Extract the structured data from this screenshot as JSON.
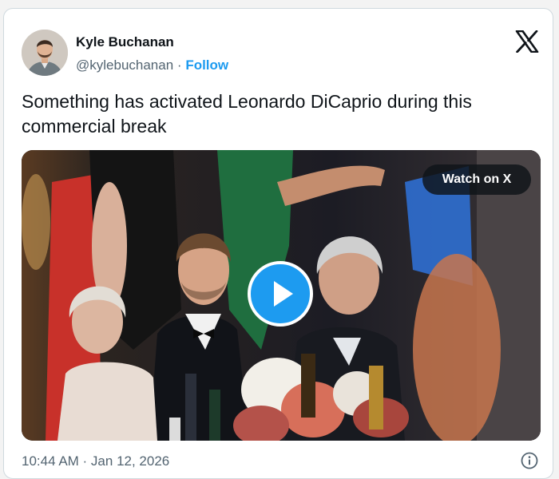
{
  "tweet": {
    "author_name": "Kyle Buchanan",
    "handle": "@kylebuchanan",
    "separator": "·",
    "follow_label": "Follow",
    "text": "Something has activated Leonardo DiCaprio during this commercial break",
    "watch_label": "Watch on X",
    "timestamp": "10:44 AM · Jan 12, 2026"
  },
  "icons": {
    "brand": "x-logo-icon",
    "media_action": "play-icon",
    "footer": "info-icon"
  },
  "colors": {
    "accent": "#1d9bf0",
    "text_primary": "#0f1419",
    "text_secondary": "#536471",
    "border": "#cfd9de"
  }
}
